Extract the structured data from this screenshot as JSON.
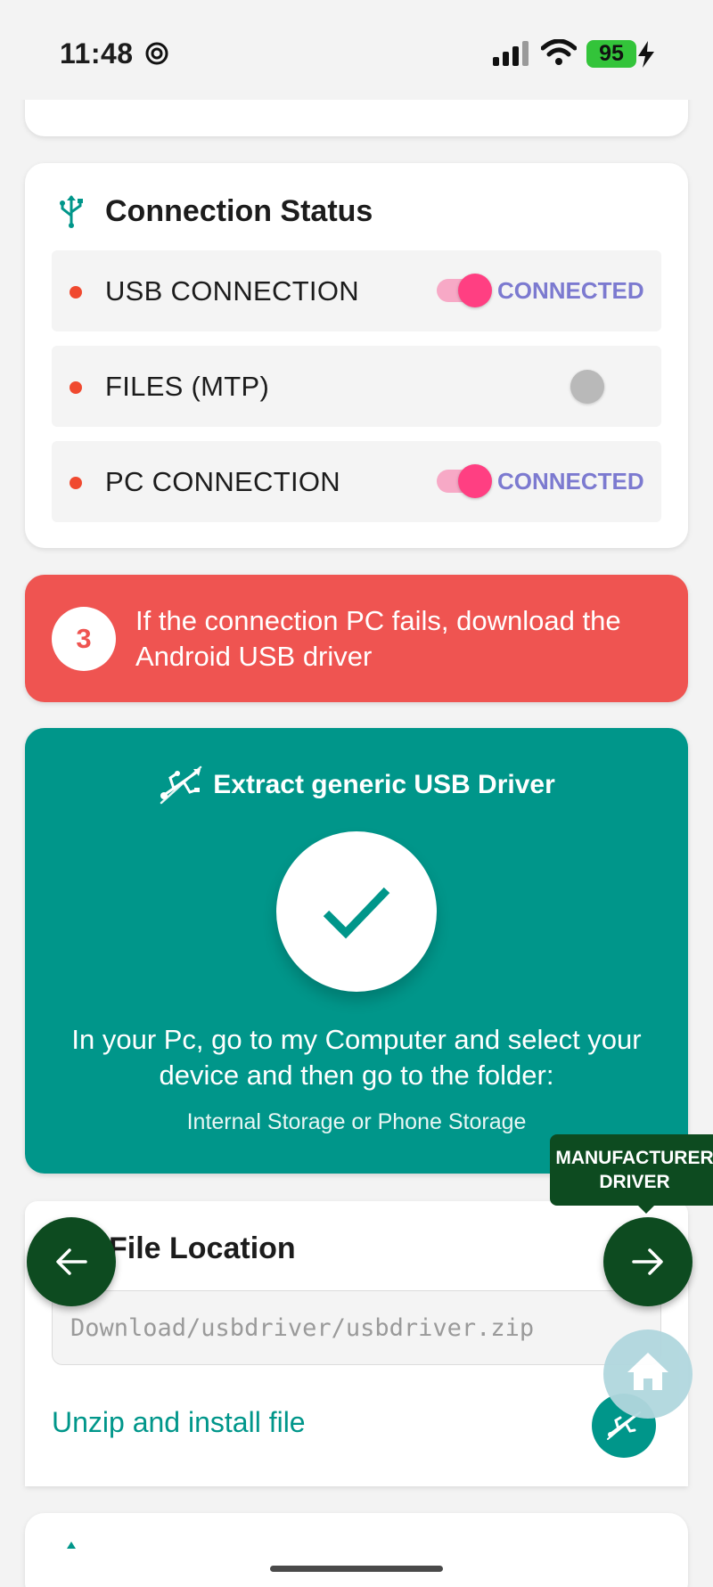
{
  "status_bar": {
    "time": "11:48",
    "battery": "95"
  },
  "connection_status": {
    "title": "Connection Status",
    "rows": [
      {
        "label": "USB CONNECTION",
        "toggle_on": true,
        "status": "CONNECTED"
      },
      {
        "label": "FILES (MTP)",
        "toggle_on": false,
        "status": ""
      },
      {
        "label": "PC CONNECTION",
        "toggle_on": true,
        "status": "CONNECTED"
      }
    ]
  },
  "warning": {
    "step_number": "3",
    "text": "If the connection PC fails, download the Android USB driver"
  },
  "extract": {
    "title": "Extract generic USB Driver",
    "instruction": "In your Pc, go to my Computer and select your device and then go to the folder:",
    "sub": "Internal Storage or Phone Storage"
  },
  "file_location": {
    "title": "File Location",
    "path": "Download/usbdriver/usbdriver.zip",
    "link": "Unzip and install file"
  },
  "nav": {
    "tooltip": "MANUFACTURER DRIVER"
  },
  "colors": {
    "teal": "#00968a",
    "warning_red": "#ef5451",
    "dark_green": "#0d4b20",
    "toggle_pink": "#ff3f82",
    "connected_purple": "#7c7ad0"
  }
}
